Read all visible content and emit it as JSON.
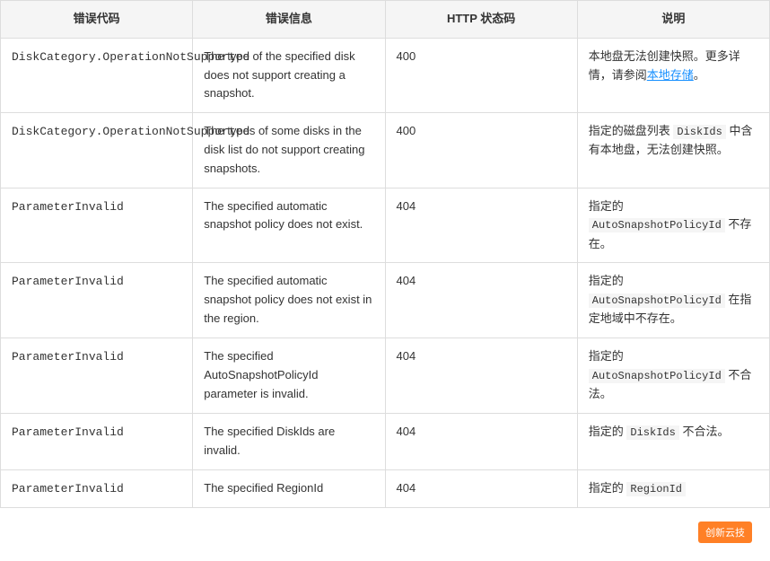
{
  "table": {
    "headers": [
      "错误代码",
      "错误信息",
      "HTTP 状态码",
      "说明"
    ],
    "rows": [
      {
        "code": "DiskCategory.OperationNotSupported",
        "message": "The type of the specified disk does not support creating a snapshot.",
        "http": "400",
        "desc_parts": [
          {
            "type": "text",
            "value": "本地盘无法创建快照。更多详情，请参阅"
          },
          {
            "type": "link",
            "value": "本地存储"
          },
          {
            "type": "text",
            "value": "。"
          }
        ]
      },
      {
        "code": "DiskCategory.OperationNotSupported",
        "message": "The types of some disks in the disk list do not support creating snapshots.",
        "http": "400",
        "desc_parts": [
          {
            "type": "text",
            "value": "指定的磁盘列表"
          },
          {
            "type": "code",
            "value": "DiskIds"
          },
          {
            "type": "text",
            "value": "中含有本地盘，无法创建快照。"
          }
        ]
      },
      {
        "code": "ParameterInvalid",
        "message": "The specified automatic snapshot policy does not exist.",
        "http": "404",
        "desc_parts": [
          {
            "type": "text",
            "value": "指定的"
          },
          {
            "type": "code",
            "value": "AutoSnapshotPolicyId"
          },
          {
            "type": "text",
            "value": "不存在。"
          }
        ]
      },
      {
        "code": "ParameterInvalid",
        "message": "The specified automatic snapshot policy does not exist in the region.",
        "http": "404",
        "desc_parts": [
          {
            "type": "text",
            "value": "指定的"
          },
          {
            "type": "code",
            "value": "AutoSnapshotPolicyId"
          },
          {
            "type": "text",
            "value": "在指定地域中不存在。"
          }
        ]
      },
      {
        "code": "ParameterInvalid",
        "message": "The specified AutoSnapshotPolicyId parameter is invalid.",
        "http": "404",
        "desc_parts": [
          {
            "type": "text",
            "value": "指定的"
          },
          {
            "type": "code",
            "value": "AutoSnapshotPolicyId"
          },
          {
            "type": "text",
            "value": "不合法。"
          }
        ]
      },
      {
        "code": "ParameterInvalid",
        "message": "The specified DiskIds are invalid.",
        "http": "404",
        "desc_parts": [
          {
            "type": "text",
            "value": "指定的"
          },
          {
            "type": "code",
            "value": "DiskIds"
          },
          {
            "type": "text",
            "value": "不合法。"
          }
        ]
      },
      {
        "code": "ParameterInvalid",
        "message": "The specified RegionId",
        "http": "404",
        "desc_parts": [
          {
            "type": "text",
            "value": "指定的"
          },
          {
            "type": "code",
            "value": "RegionId"
          }
        ]
      }
    ]
  },
  "watermark": {
    "label": "创新云技"
  }
}
